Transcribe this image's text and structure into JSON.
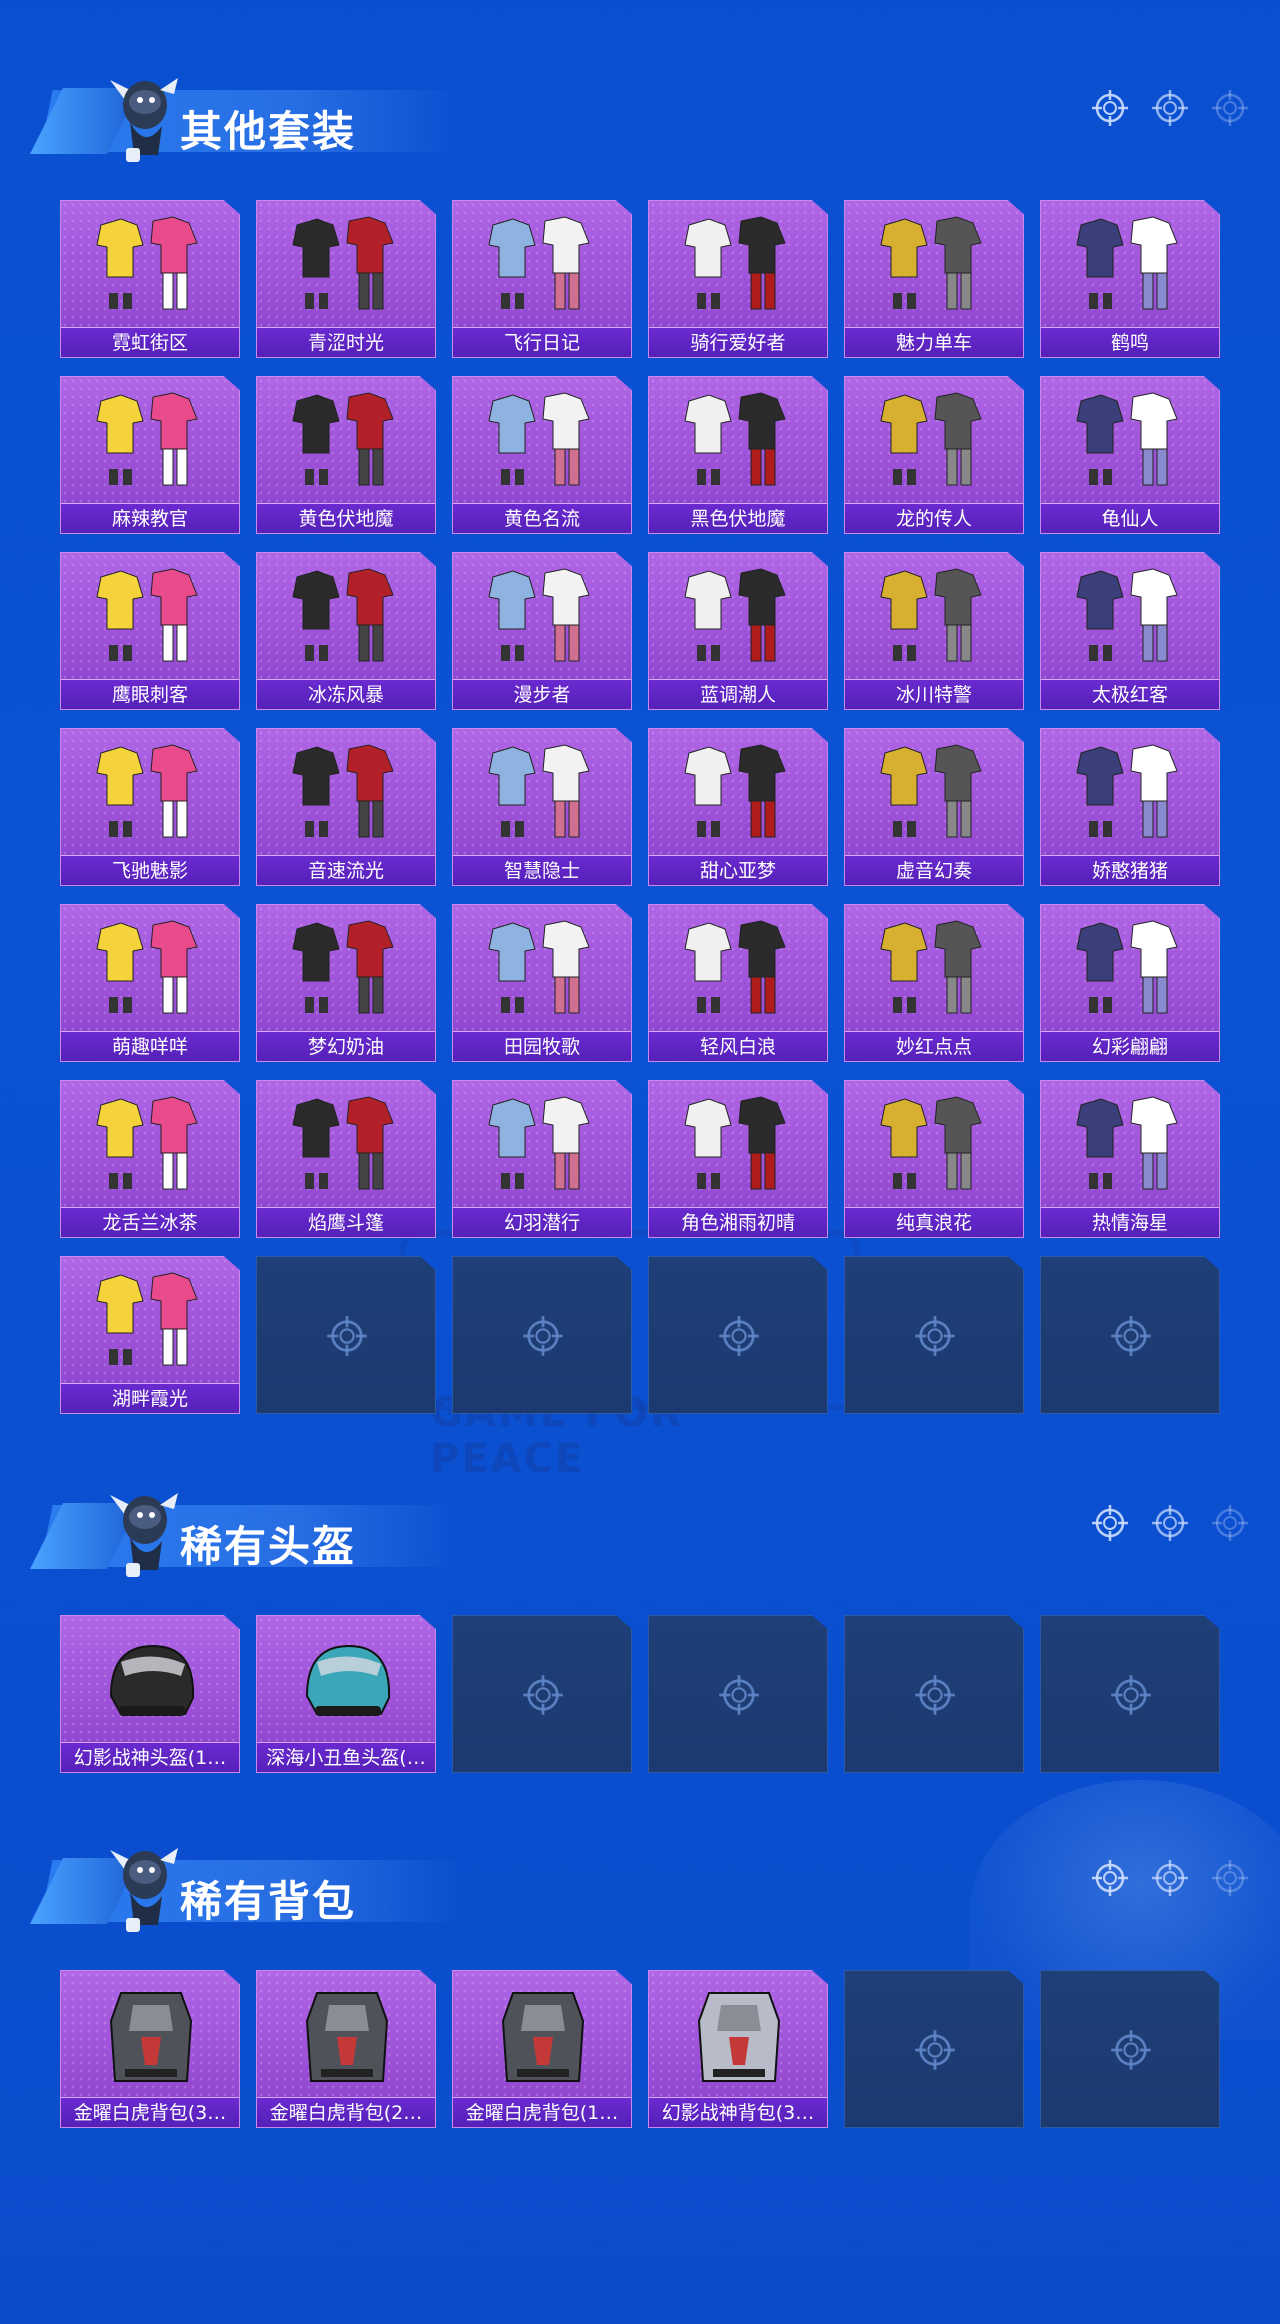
{
  "sections": [
    {
      "title": "其他套装",
      "items": [
        "霓虹街区",
        "青涩时光",
        "飞行日记",
        "骑行爱好者",
        "魅力单车",
        "鹤鸣",
        "麻辣教官",
        "黄色伏地魔",
        "黄色名流",
        "黑色伏地魔",
        "龙的传人",
        "龟仙人",
        "鹰眼刺客",
        "冰冻风暴",
        "漫步者",
        "蓝调潮人",
        "冰川特警",
        "太极红客",
        "飞驰魅影",
        "音速流光",
        "智慧隐士",
        "甜心亚梦",
        "虚音幻奏",
        "娇憨猪猪",
        "萌趣咩咩",
        "梦幻奶油",
        "田园牧歌",
        "轻风白浪",
        "妙红点点",
        "幻彩翩翩",
        "龙舌兰冰茶",
        "焰鹰斗篷",
        "幻羽潜行",
        "角色湘雨初晴",
        "纯真浪花",
        "热情海星",
        "湖畔霞光"
      ],
      "empty_slots": 5
    },
    {
      "title": "稀有头盔",
      "items": [
        "幻影战神头盔(1…",
        "深海小丑鱼头盔(…"
      ],
      "empty_slots": 4
    },
    {
      "title": "稀有背包",
      "items": [
        "金曜白虎背包(3…",
        "金曜白虎背包(2…",
        "金曜白虎背包(1…",
        "幻影战神背包(3…"
      ],
      "empty_slots": 2
    }
  ],
  "background_text": "GAME FOR PEACE",
  "colors": {
    "background": "#0a4fd0",
    "card_filled": "#a85ce0",
    "card_label": "#6a2ad0",
    "card_empty": "#1e3f78",
    "icon": "#bcd4ff"
  },
  "icons": {
    "header_decor": "crosshair-icon",
    "empty_slot": "crosshair-icon",
    "mascot": "mascot-icon"
  }
}
